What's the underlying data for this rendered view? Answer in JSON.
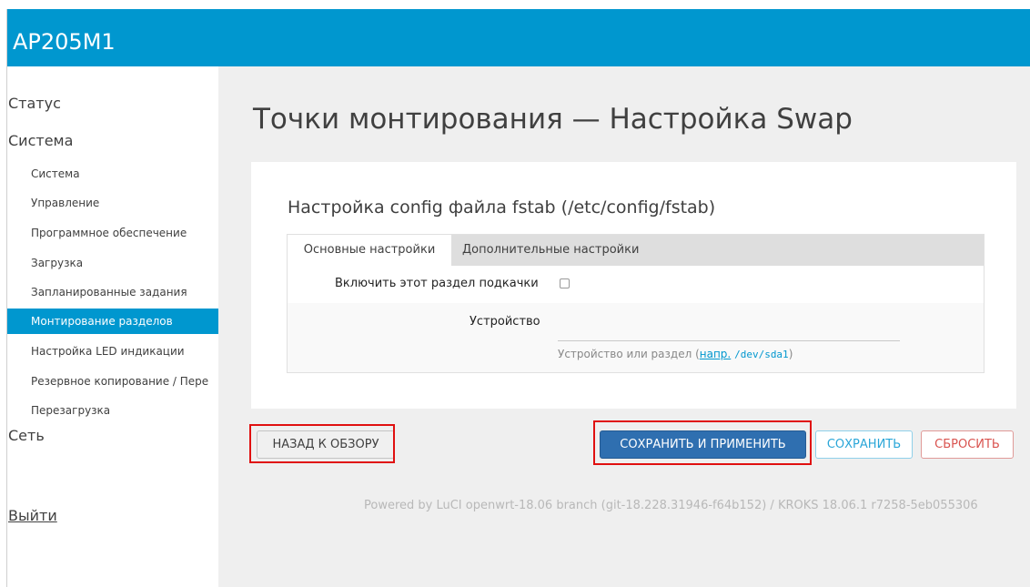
{
  "header": {
    "brand": "AP205M1"
  },
  "sidebar": {
    "status": "Статус",
    "system": "Система",
    "items": [
      "Система",
      "Управление",
      "Программное обеспечение",
      "Загрузка",
      "Запланированные задания",
      "Монтирование разделов",
      "Настройка LED индикации",
      "Резервное копирование / Пере",
      "Перезагрузка"
    ],
    "active_item": "Монтирование разделов",
    "network": "Сеть",
    "logout": "Выйти"
  },
  "main": {
    "title": "Точки монтирования — Настройка Swap",
    "section_title": "Настройка config файла fstab (/etc/config/fstab)",
    "tabs": [
      {
        "label": "Основные настройки",
        "active": true
      },
      {
        "label": "Дополнительные настройки",
        "active": false
      }
    ],
    "enable_label": "Включить этот раздел подкачки",
    "enable_checked": false,
    "device_label": "Устройство",
    "device_value": "",
    "device_hint_prefix": "Устройство или раздел (",
    "device_hint_link": "напр.",
    "device_hint_example": "/dev/sda1",
    "device_hint_suffix": ")"
  },
  "buttons": {
    "back": "НАЗАД К ОБЗОРУ",
    "save_apply": "СОХРАНИТЬ И ПРИМЕНИТЬ",
    "save": "СОХРАНИТЬ",
    "reset": "СБРОСИТЬ"
  },
  "footer": {
    "text": "Powered by LuCI openwrt-18.06 branch (git-18.228.31946-f64b152) / KROKS 18.06.1 r7258-5eb055306"
  },
  "colors": {
    "header": "#0097cf",
    "active_nav": "#0097cf",
    "primary_button": "#2f6fb0",
    "reset_text": "#d9534f",
    "highlight": "#e01010"
  }
}
